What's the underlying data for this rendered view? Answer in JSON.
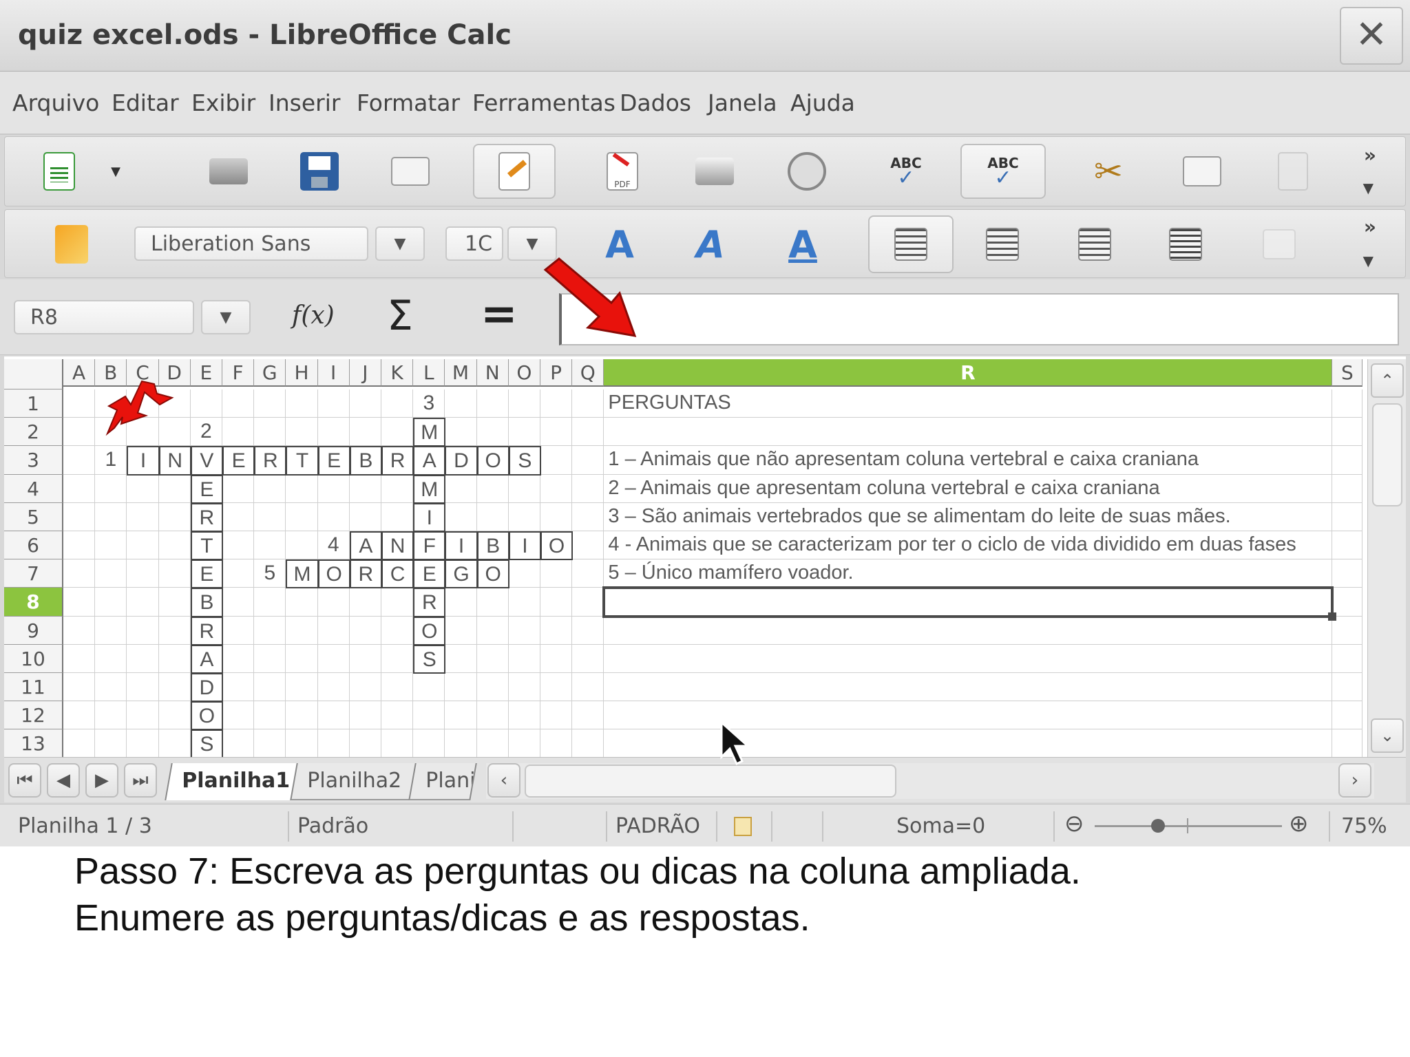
{
  "window": {
    "title": "quiz excel.ods - LibreOffice Calc",
    "close": "✕"
  },
  "menu": [
    "Arquivo",
    "Editar",
    "Exibir",
    "Inserir",
    "Formatar",
    "Ferramentas",
    "Dados",
    "Janela",
    "Ajuda"
  ],
  "formatting": {
    "font_name": "Liberation Sans",
    "font_size": "1C"
  },
  "formula_bar": {
    "name_box": "R8",
    "function_wizard": "f(x)",
    "sum": "Σ",
    "equals": "=",
    "content": ""
  },
  "columns": [
    "A",
    "B",
    "C",
    "D",
    "E",
    "F",
    "G",
    "H",
    "I",
    "J",
    "K",
    "L",
    "M",
    "N",
    "O",
    "P",
    "Q",
    "R",
    "S"
  ],
  "active_column": "R",
  "rows": [
    "1",
    "2",
    "3",
    "4",
    "5",
    "6",
    "7",
    "8",
    "9",
    "10",
    "11",
    "12",
    "13"
  ],
  "active_row": "8",
  "cells": {
    "L1": "3",
    "R1": "PERGUNTAS",
    "E2": "2",
    "L2": "M",
    "B3": "1",
    "C3": "I",
    "D3": "N",
    "E3": "V",
    "F3": "E",
    "G3": "R",
    "H3": "T",
    "I3": "E",
    "J3": "B",
    "K3": "R",
    "L3": "A",
    "M3": "D",
    "N3": "O",
    "O3": "S",
    "R3": "1 – Animais que não apresentam coluna vertebral e caixa craniana",
    "E4": "E",
    "L4": "M",
    "R4": "2 – Animais que apresentam coluna vertebral e caixa craniana",
    "E5": "R",
    "L5": "I",
    "R5": "3 – São animais vertebrados que se alimentam do leite de suas mães.",
    "I6": "4",
    "E6": "T",
    "J6": "A",
    "K6": "N",
    "L6": "F",
    "M6": "I",
    "N6": "B",
    "O6": "I",
    "P6": "O",
    "R6": "4 - Animais que se caracterizam por ter o ciclo de vida dividido em duas fases",
    "E7": "E",
    "G7": "5",
    "H7": "M",
    "I7": "O",
    "J7": "R",
    "K7": "C",
    "L7": "E",
    "M7": "G",
    "N7": "O",
    "R7": "5 – Único mamífero voador.",
    "E8": "B",
    "L8": "R",
    "E9": "R",
    "L9": "O",
    "E10": "A",
    "L10": "S",
    "E11": "D",
    "E12": "O",
    "E13": "S"
  },
  "sheets": [
    "Planilha1",
    "Planilha2",
    "Plani"
  ],
  "active_sheet": "Planilha1",
  "status": {
    "sheet": "Planilha 1 / 3",
    "style": "Padrão",
    "mode": "PADRÃO",
    "sum": "Soma=0",
    "zoom": "75%",
    "zoom_level_percent": 75
  },
  "caption": {
    "line1": "Passo 7: Escreva as perguntas ou dicas na coluna ampliada.",
    "line2": "Enumere as perguntas/dicas e as respostas."
  },
  "colors": {
    "active_header": "#8cc43f",
    "arrow": "#e8120c"
  }
}
